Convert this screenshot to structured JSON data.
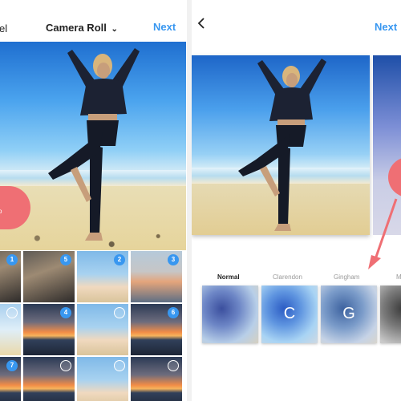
{
  "left": {
    "cancel_label": "el",
    "title": "Camera Roll",
    "next_label": "Next",
    "grid_badges": [
      "1",
      "5",
      "2",
      "3",
      "4",
      "6",
      "7"
    ]
  },
  "right": {
    "next_label": "Next",
    "filters": [
      "Normal",
      "Clarendon",
      "Gingham",
      "M"
    ],
    "thumb_letters": [
      "C",
      "G"
    ]
  },
  "colors": {
    "accent": "#3897f0",
    "highlight": "#ef6f74"
  },
  "icons": {
    "back": "chevron-left-icon",
    "title_dropdown": "chevron-down-icon",
    "multi_select": "multi-select-icon"
  }
}
